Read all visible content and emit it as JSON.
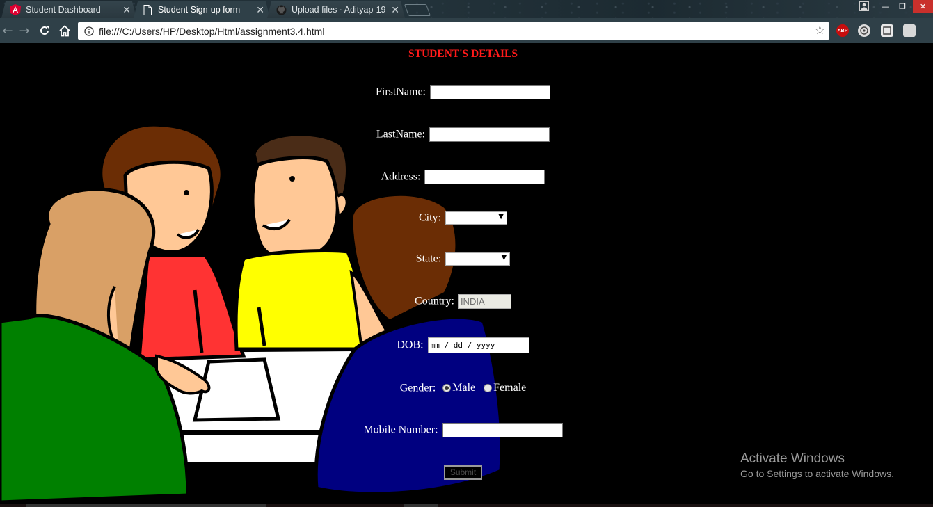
{
  "browser": {
    "tabs": [
      {
        "title": "Student Dashboard",
        "active": false,
        "icon": "angular-icon"
      },
      {
        "title": "Student Sign-up form",
        "active": true,
        "icon": "page-icon"
      },
      {
        "title": "Upload files · Adityap-19",
        "active": false,
        "icon": "github-icon"
      }
    ],
    "address": "file:///C:/Users/HP/Desktop/Html/assignment3.4.html",
    "extensions": [
      "abp-icon",
      "extension-icon",
      "extension-icon",
      "extension-icon"
    ]
  },
  "form": {
    "heading": "STUDENT'S DETAILS",
    "first_name_label": "FirstName:",
    "last_name_label": "LastName:",
    "address_label": "Address:",
    "city_label": "City:",
    "state_label": "State:",
    "country_label": "Country:",
    "country_value": "INDIA",
    "dob_label": "DOB:",
    "dob_placeholder": "mm / dd / yyyy",
    "gender_label": "Gender:",
    "gender_options": [
      "Male",
      "Female"
    ],
    "gender_selected": "Male",
    "mobile_label": "Mobile Number:",
    "submit_label": "Submit"
  },
  "watermark": {
    "line1": "Activate Windows",
    "line2": "Go to Settings to activate Windows."
  },
  "colors": {
    "heading": "#ff1a1a",
    "shirt_red": "#ff3333",
    "shirt_yellow": "#ffff00",
    "shirt_green": "#008000",
    "shirt_navy": "#000080"
  }
}
